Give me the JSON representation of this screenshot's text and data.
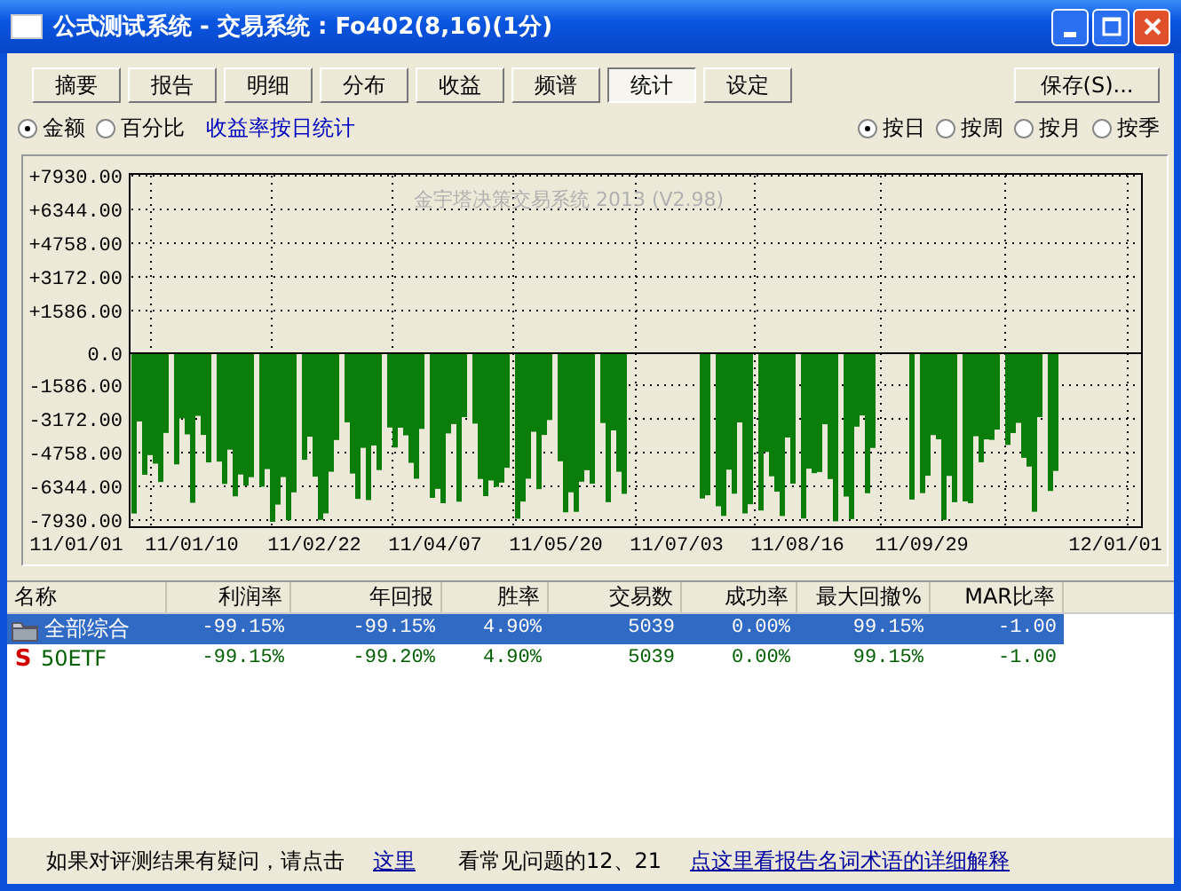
{
  "window": {
    "title": "公式测试系统 - 交易系统 : Fo402(8,16)(1分)"
  },
  "tabs": [
    {
      "label": "摘要",
      "selected": false
    },
    {
      "label": "报告",
      "selected": false
    },
    {
      "label": "明细",
      "selected": false
    },
    {
      "label": "分布",
      "selected": false
    },
    {
      "label": "收益",
      "selected": false
    },
    {
      "label": "频谱",
      "selected": false
    },
    {
      "label": "统计",
      "selected": true
    },
    {
      "label": "设定",
      "selected": false
    }
  ],
  "save_button": "保存(S)...",
  "mode_options": [
    {
      "label": "金额",
      "selected": true
    },
    {
      "label": "百分比",
      "selected": false
    }
  ],
  "mode_caption": "收益率按日统计",
  "period_options": [
    {
      "label": "按日",
      "selected": true
    },
    {
      "label": "按周",
      "selected": false
    },
    {
      "label": "按月",
      "selected": false
    },
    {
      "label": "按季",
      "selected": false
    }
  ],
  "chart": {
    "watermark": "金宇塔决策交易系统 2013 (V2.98)",
    "y_tick_labels": [
      "+7930.00",
      "+6344.00",
      "+4758.00",
      "+3172.00",
      "+1586.00",
      "0.0",
      "-1586.00",
      "-3172.00",
      "-4758.00",
      "-6344.00",
      "-7930.00"
    ],
    "x_tick_labels": [
      "11/01/01",
      "11/01/10",
      "11/02/22",
      "11/04/07",
      "11/05/20",
      "11/07/03",
      "11/08/16",
      "11/09/29",
      "12/01/01"
    ]
  },
  "table": {
    "columns": [
      "名称",
      "利润率",
      "年回报",
      "胜率",
      "交易数",
      "成功率",
      "最大回撤%",
      "MAR比率"
    ],
    "rows": [
      {
        "kind": "group",
        "selected": true,
        "cells": [
          "全部综合",
          "-99.15%",
          "-99.15%",
          "4.90%",
          "5039",
          "0.00%",
          "99.15%",
          "-1.00"
        ]
      },
      {
        "kind": "stock",
        "icon_text": "S",
        "selected": false,
        "cells": [
          "50ETF",
          "-99.15%",
          "-99.20%",
          "4.90%",
          "5039",
          "0.00%",
          "99.15%",
          "-1.00"
        ]
      }
    ]
  },
  "footer": {
    "prompt": "如果对评测结果有疑问，请点击",
    "link": "这里",
    "note": "看常见问题的12、21",
    "glossary_link": "点这里看报告名词术语的详细解释"
  }
}
